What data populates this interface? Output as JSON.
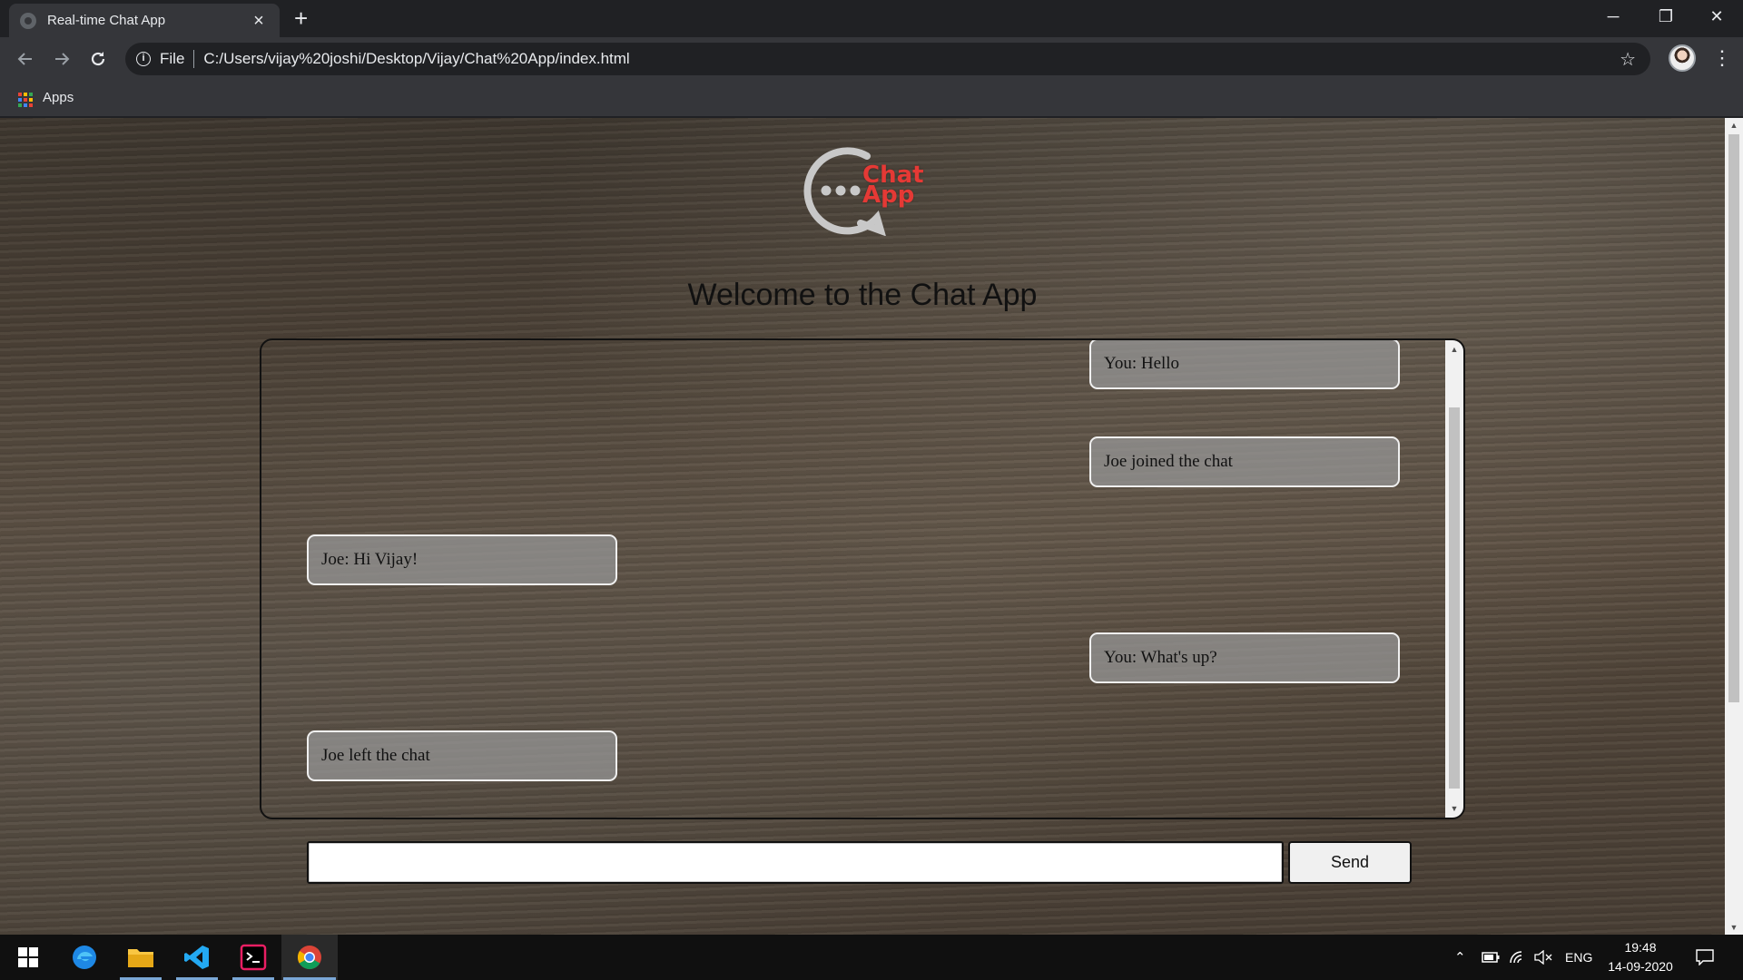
{
  "browser": {
    "tab_title": "Real-time Chat App",
    "tab_close": "×",
    "new_tab": "+",
    "scheme_label": "File",
    "url": "C:/Users/vijay%20joshi/Desktop/Vijay/Chat%20App/index.html",
    "bookmarks": [
      {
        "label": "Apps",
        "icon": "apps-grid-icon"
      }
    ],
    "window_controls": {
      "minimize": "─",
      "restore": "❐",
      "close": "✕"
    }
  },
  "page": {
    "logo_text_line1": "Chat",
    "logo_text_line2": "App",
    "heading": "Welcome to the Chat App",
    "messages": [
      {
        "text": "You: Hello",
        "side": "right"
      },
      {
        "text": "Joe joined the chat",
        "side": "right"
      },
      {
        "text": "Joe: Hi Vijay!",
        "side": "left"
      },
      {
        "text": "You: What's up?",
        "side": "right"
      },
      {
        "text": "Joe left the chat",
        "side": "left"
      }
    ],
    "input_value": "",
    "send_label": "Send"
  },
  "taskbar": {
    "apps": [
      "windows-start-icon",
      "edge-icon",
      "file-explorer-icon",
      "vscode-icon",
      "terminal-icon",
      "chrome-icon"
    ],
    "language": "ENG",
    "time": "19:48",
    "date": "14-09-2020"
  },
  "colors": {
    "logo_accent": "#e53935",
    "logo_ring": "#c8c8c8",
    "chrome_dark": "#202124",
    "chrome_toolbar": "#35363a"
  }
}
